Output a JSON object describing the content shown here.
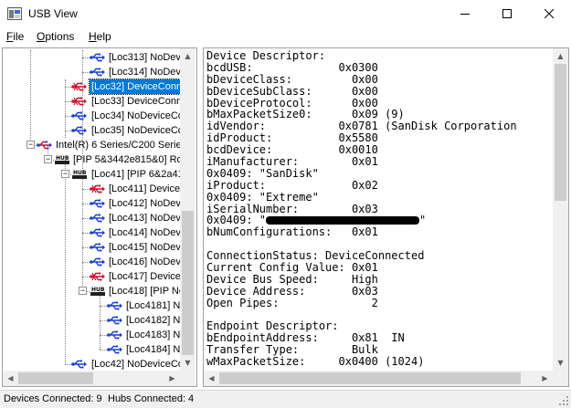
{
  "window": {
    "title": "USB View",
    "minimize": "—",
    "maximize": "☐",
    "close": "✕"
  },
  "menu": {
    "file": "File",
    "options": "Options",
    "help": "Help"
  },
  "tree": {
    "rows": [
      {
        "label": "[Loc313] NoDevi",
        "icon": "usb-port-icon"
      },
      {
        "label": "[Loc314] NoDevi",
        "icon": "usb-port-icon"
      },
      {
        "label": "[Loc32] DeviceConn",
        "icon": "usb-device-icon"
      },
      {
        "label": "[Loc33] DeviceConn",
        "icon": "usb-device-icon"
      },
      {
        "label": "[Loc34] NoDeviceCo",
        "icon": "usb-port-icon"
      },
      {
        "label": "[Loc35] NoDeviceCo",
        "icon": "usb-port-icon"
      },
      {
        "label": "Intel(R) 6 Series/C200 Series",
        "icon": "usb-controller-icon"
      },
      {
        "label": "[PIP 5&3442e815&0] Ro",
        "icon": "usb-hub-icon"
      },
      {
        "label": "[Loc41] [PIP 6&2a41",
        "icon": "usb-hub-icon"
      },
      {
        "label": "[Loc411] Device",
        "icon": "usb-device-icon"
      },
      {
        "label": "[Loc412] NoDev",
        "icon": "usb-port-icon"
      },
      {
        "label": "[Loc413] NoDev",
        "icon": "usb-port-icon"
      },
      {
        "label": "[Loc414] NoDev",
        "icon": "usb-port-icon"
      },
      {
        "label": "[Loc415] NoDev",
        "icon": "usb-port-icon"
      },
      {
        "label": "[Loc416] NoDev",
        "icon": "usb-port-icon"
      },
      {
        "label": "[Loc417] Device",
        "icon": "usb-device-icon"
      },
      {
        "label": "[Loc418] [PIP Ne",
        "icon": "usb-hub-icon"
      },
      {
        "label": "[Loc4181] N",
        "icon": "usb-port-icon"
      },
      {
        "label": "[Loc4182] N",
        "icon": "usb-port-icon"
      },
      {
        "label": "[Loc4183] N",
        "icon": "usb-port-icon"
      },
      {
        "label": "[Loc4184] N",
        "icon": "usb-port-icon"
      },
      {
        "label": "[Loc42] NoDeviceCo",
        "icon": "usb-port-icon"
      }
    ],
    "hub_icon_text": "HUB"
  },
  "detail": {
    "lines": [
      "Device Descriptor:",
      "bcdUSB:             0x0300",
      "bDeviceClass:         0x00",
      "bDeviceSubClass:      0x00",
      "bDeviceProtocol:      0x00",
      "bMaxPacketSize0:      0x09 (9)",
      "idVendor:           0x0781 (SanDisk Corporation",
      "idProduct:          0x5580",
      "bcdDevice:          0x0010",
      "iManufacturer:        0x01",
      "0x0409: \"SanDisk\"",
      "iProduct:             0x02",
      "0x0409: \"Extreme\"",
      "iSerialNumber:        0x03",
      "0x0409: \"",
      "bNumConfigurations:   0x01",
      "",
      "ConnectionStatus: DeviceConnected",
      "Current Config Value: 0x01",
      "Device Bus Speed:     High",
      "Device Address:       0x03",
      "Open Pipes:              2",
      "",
      "Endpoint Descriptor:",
      "bEndpointAddress:     0x81  IN",
      "Transfer Type:        Bulk",
      "wMaxPacketSize:     0x0400 (1024)"
    ],
    "serial_suffix": "\""
  },
  "status": {
    "devices": "Devices Connected: 9",
    "hubs": "Hubs Connected: 4"
  },
  "colors": {
    "selection": "#0078d7",
    "usb_blue": "#1a3fcf",
    "usb_red": "#c8102e"
  }
}
